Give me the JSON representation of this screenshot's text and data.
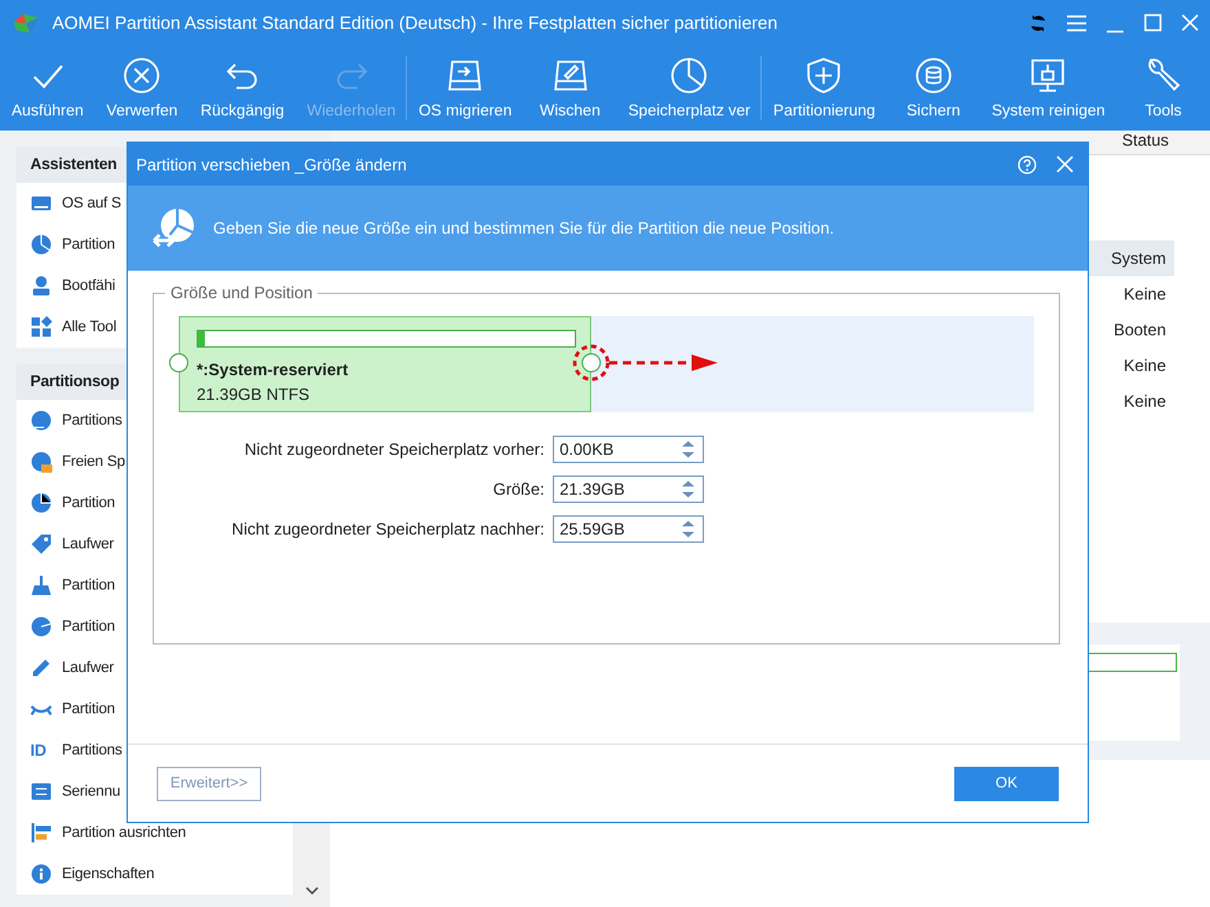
{
  "window": {
    "title": "AOMEI Partition Assistant Standard Edition (Deutsch) - Ihre Festplatten sicher partitionieren"
  },
  "toolbar": [
    {
      "label": "Ausführen",
      "disabled": false,
      "separator_after": false
    },
    {
      "label": "Verwerfen",
      "disabled": false,
      "separator_after": false
    },
    {
      "label": "Rückgängig",
      "disabled": false,
      "separator_after": false
    },
    {
      "label": "Wiederholen",
      "disabled": true,
      "separator_after": true
    },
    {
      "label": "OS migrieren",
      "disabled": false,
      "separator_after": false
    },
    {
      "label": "Wischen",
      "disabled": false,
      "separator_after": false
    },
    {
      "label": "Speicherplatz ver",
      "disabled": false,
      "separator_after": true
    },
    {
      "label": "Partitionierung",
      "disabled": false,
      "separator_after": false
    },
    {
      "label": "Sichern",
      "disabled": false,
      "separator_after": false
    },
    {
      "label": "System reinigen",
      "disabled": false,
      "separator_after": false
    },
    {
      "label": "Tools",
      "disabled": false,
      "separator_after": false
    }
  ],
  "sidebar": {
    "sections": [
      {
        "title": "Assistenten",
        "items": [
          {
            "label": "OS auf S"
          },
          {
            "label": "Partition"
          },
          {
            "label": "Bootfähi"
          },
          {
            "label": "Alle Tool"
          }
        ]
      },
      {
        "title": "Partitionsop",
        "items": [
          {
            "label": "Partitions"
          },
          {
            "label": "Freien Sp"
          },
          {
            "label": "Partition"
          },
          {
            "label": "Laufwer"
          },
          {
            "label": "Partition"
          },
          {
            "label": "Partition"
          },
          {
            "label": "Laufwer"
          },
          {
            "label": "Partition"
          },
          {
            "label": "Partitions",
            "icon_text": "ID"
          },
          {
            "label": "Seriennu"
          },
          {
            "label": "Partition ausrichten"
          },
          {
            "label": "Eigenschaften"
          }
        ]
      }
    ]
  },
  "table": {
    "columns": [
      "Status"
    ],
    "rows": [
      {
        "status": "System",
        "selected": true
      },
      {
        "status": "Keine",
        "selected": false
      },
      {
        "status": "Booten",
        "selected": false
      },
      {
        "status": "Keine",
        "selected": false
      },
      {
        "status": "Keine",
        "selected": false
      }
    ]
  },
  "dialog": {
    "title": "Partition verschieben _Größe ändern",
    "banner": "Geben Sie die neue Größe ein und bestimmen Sie für die Partition die neue Position.",
    "group_title": "Größe und Position",
    "partition": {
      "name": "*:System-reserviert",
      "info": "21.39GB NTFS",
      "level": 0.02
    },
    "fields": [
      {
        "label": "Nicht zugeordneter Speicherplatz vorher:",
        "value": "0.00KB"
      },
      {
        "label": "Größe:",
        "value": "21.39GB"
      },
      {
        "label": "Nicht zugeordneter Speicherplatz nachher:",
        "value": "25.59GB"
      }
    ],
    "buttons": [
      {
        "label": "Erweitert>>",
        "kind": "secondary"
      },
      {
        "label": "OK",
        "kind": "primary"
      }
    ]
  }
}
